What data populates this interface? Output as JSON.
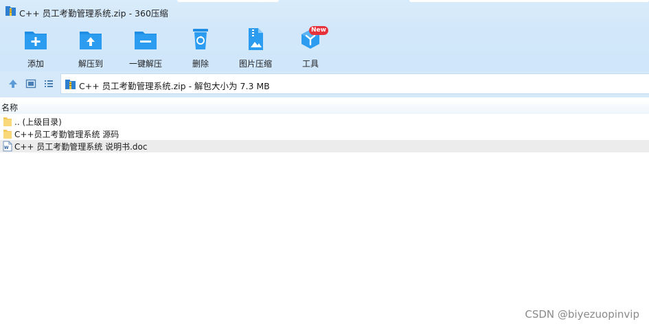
{
  "window": {
    "title": "C++ 员工考勤管理系统.zip - 360压缩"
  },
  "toolbar": {
    "items": [
      {
        "label": "添加",
        "icon": "add-folder-icon"
      },
      {
        "label": "解压到",
        "icon": "extract-to-icon"
      },
      {
        "label": "一键解压",
        "icon": "one-click-extract-icon"
      },
      {
        "label": "删除",
        "icon": "delete-icon"
      },
      {
        "label": "图片压缩",
        "icon": "image-compress-icon"
      },
      {
        "label": "工具",
        "icon": "tools-icon",
        "badge": "New"
      }
    ]
  },
  "address": {
    "path": "C++ 员工考勤管理系统.zip - 解包大小为 7.3 MB"
  },
  "list": {
    "column_name": "名称",
    "rows": [
      {
        "name": ".. (上级目录)",
        "icon": "folder-icon"
      },
      {
        "name": "C++员工考勤管理系统 源码",
        "icon": "folder-icon"
      },
      {
        "name": "C++ 员工考勤管理系统 说明书.doc",
        "icon": "word-doc-icon"
      }
    ]
  },
  "watermark": "CSDN @biyezuopinvip",
  "colors": {
    "accent": "#1f8fe6",
    "toolbar_bg": "#d3e8fa",
    "selected_row": "#ececec",
    "badge": "#e8323b"
  }
}
